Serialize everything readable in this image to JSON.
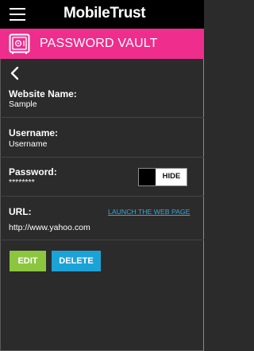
{
  "header": {
    "brand": "MobileTrust",
    "section_title": "PASSWORD VAULT"
  },
  "fields": {
    "website": {
      "label": "Website Name:",
      "value": "Sample"
    },
    "username": {
      "label": "Username:",
      "value": "Username"
    },
    "password": {
      "label": "Password:",
      "value": "********",
      "toggle_label": "HIDE"
    },
    "url": {
      "label": "URL:",
      "value": "http://www.yahoo.com",
      "launch_label": "LAUNCH THE WEB PAGE"
    }
  },
  "actions": {
    "edit_label": "EDIT",
    "delete_label": "DELETE"
  },
  "colors": {
    "accent_pink": "#ee2d8d",
    "edit_green": "#8cc63f",
    "delete_blue": "#1ba3d8",
    "link_blue": "#3aa6d6"
  },
  "icons": {
    "menu": "hamburger-menu-icon",
    "vault": "safe-icon",
    "back": "back-arrow-icon"
  }
}
